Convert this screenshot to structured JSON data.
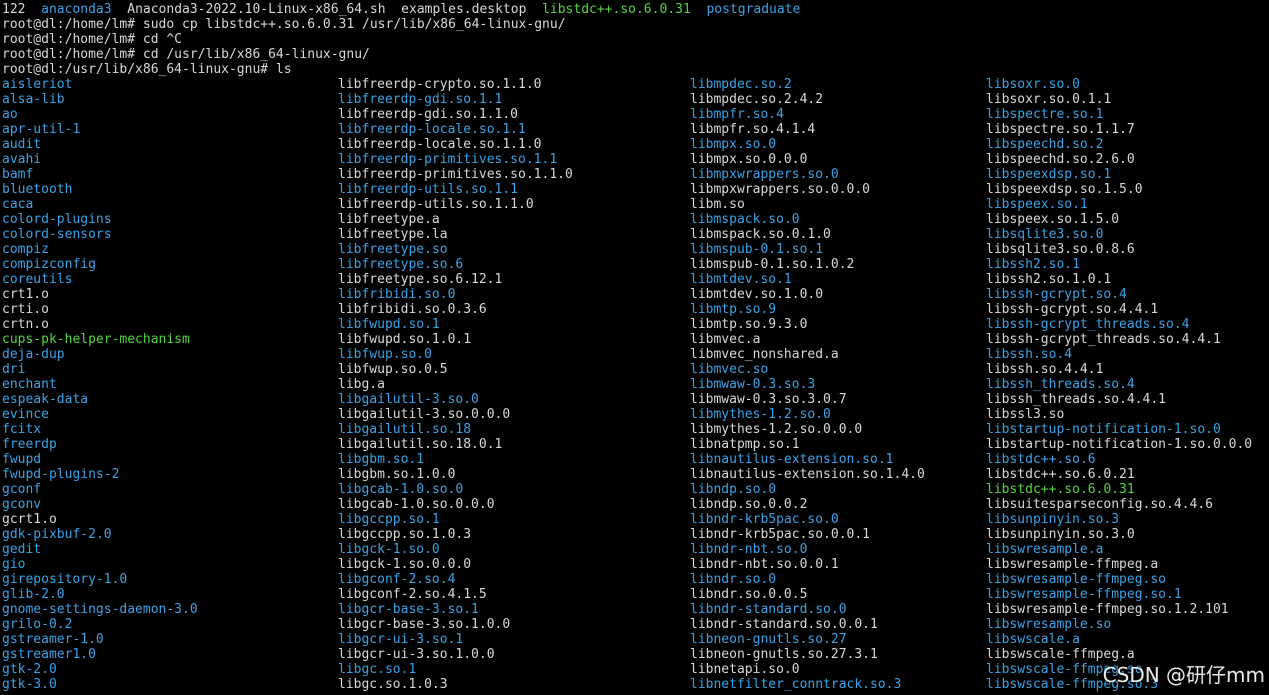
{
  "colors": {
    "background": "#000000",
    "default": "#d8d8d8",
    "blue": "#3ca2e6",
    "green": "#53d63e"
  },
  "top_lines": [
    [
      {
        "text": "122  ",
        "color": "default"
      },
      {
        "text": "anaconda3",
        "color": "blue"
      },
      {
        "text": "  Anaconda3-2022.10-Linux-x86_64.sh  examples.desktop  ",
        "color": "default"
      },
      {
        "text": "libstdc++.so.6.0.31",
        "color": "green"
      },
      {
        "text": "  ",
        "color": "default"
      },
      {
        "text": "postgraduate",
        "color": "blue"
      }
    ],
    [
      {
        "text": "root@dl:/home/lm# sudo cp libstdc++.so.6.0.31 /usr/lib/x86_64-linux-gnu/",
        "color": "default"
      }
    ],
    [
      {
        "text": "root@dl:/home/lm# cd ^C",
        "color": "default"
      }
    ],
    [
      {
        "text": "root@dl:/home/lm# cd /usr/lib/x86_64-linux-gnu/",
        "color": "default"
      }
    ],
    [
      {
        "text": "root@dl:/usr/lib/x86_64-linux-gnu# ls",
        "color": "default"
      }
    ]
  ],
  "ls_columns": [
    [
      {
        "text": "aisleriot",
        "color": "blue"
      },
      {
        "text": "alsa-lib",
        "color": "blue"
      },
      {
        "text": "ao",
        "color": "blue"
      },
      {
        "text": "apr-util-1",
        "color": "blue"
      },
      {
        "text": "audit",
        "color": "blue"
      },
      {
        "text": "avahi",
        "color": "blue"
      },
      {
        "text": "bamf",
        "color": "blue"
      },
      {
        "text": "bluetooth",
        "color": "blue"
      },
      {
        "text": "caca",
        "color": "blue"
      },
      {
        "text": "colord-plugins",
        "color": "blue"
      },
      {
        "text": "colord-sensors",
        "color": "blue"
      },
      {
        "text": "compiz",
        "color": "blue"
      },
      {
        "text": "compizconfig",
        "color": "blue"
      },
      {
        "text": "coreutils",
        "color": "blue"
      },
      {
        "text": "crt1.o",
        "color": "default"
      },
      {
        "text": "crti.o",
        "color": "default"
      },
      {
        "text": "crtn.o",
        "color": "default"
      },
      {
        "text": "cups-pk-helper-mechanism",
        "color": "green"
      },
      {
        "text": "deja-dup",
        "color": "blue"
      },
      {
        "text": "dri",
        "color": "blue"
      },
      {
        "text": "enchant",
        "color": "blue"
      },
      {
        "text": "espeak-data",
        "color": "blue"
      },
      {
        "text": "evince",
        "color": "blue"
      },
      {
        "text": "fcitx",
        "color": "blue"
      },
      {
        "text": "freerdp",
        "color": "blue"
      },
      {
        "text": "fwupd",
        "color": "blue"
      },
      {
        "text": "fwupd-plugins-2",
        "color": "blue"
      },
      {
        "text": "gconf",
        "color": "blue"
      },
      {
        "text": "gconv",
        "color": "blue"
      },
      {
        "text": "gcrt1.o",
        "color": "default"
      },
      {
        "text": "gdk-pixbuf-2.0",
        "color": "blue"
      },
      {
        "text": "gedit",
        "color": "blue"
      },
      {
        "text": "gio",
        "color": "blue"
      },
      {
        "text": "girepository-1.0",
        "color": "blue"
      },
      {
        "text": "glib-2.0",
        "color": "blue"
      },
      {
        "text": "gnome-settings-daemon-3.0",
        "color": "blue"
      },
      {
        "text": "grilo-0.2",
        "color": "blue"
      },
      {
        "text": "gstreamer-1.0",
        "color": "blue"
      },
      {
        "text": "gstreamer1.0",
        "color": "blue"
      },
      {
        "text": "gtk-2.0",
        "color": "blue"
      },
      {
        "text": "gtk-3.0",
        "color": "blue"
      }
    ],
    [
      {
        "text": "libfreerdp-crypto.so.1.1.0",
        "color": "default"
      },
      {
        "text": "libfreerdp-gdi.so.1.1",
        "color": "blue"
      },
      {
        "text": "libfreerdp-gdi.so.1.1.0",
        "color": "default"
      },
      {
        "text": "libfreerdp-locale.so.1.1",
        "color": "blue"
      },
      {
        "text": "libfreerdp-locale.so.1.1.0",
        "color": "default"
      },
      {
        "text": "libfreerdp-primitives.so.1.1",
        "color": "blue"
      },
      {
        "text": "libfreerdp-primitives.so.1.1.0",
        "color": "default"
      },
      {
        "text": "libfreerdp-utils.so.1.1",
        "color": "blue"
      },
      {
        "text": "libfreerdp-utils.so.1.1.0",
        "color": "default"
      },
      {
        "text": "libfreetype.a",
        "color": "default"
      },
      {
        "text": "libfreetype.la",
        "color": "default"
      },
      {
        "text": "libfreetype.so",
        "color": "blue"
      },
      {
        "text": "libfreetype.so.6",
        "color": "blue"
      },
      {
        "text": "libfreetype.so.6.12.1",
        "color": "default"
      },
      {
        "text": "libfribidi.so.0",
        "color": "blue"
      },
      {
        "text": "libfribidi.so.0.3.6",
        "color": "default"
      },
      {
        "text": "libfwupd.so.1",
        "color": "blue"
      },
      {
        "text": "libfwupd.so.1.0.1",
        "color": "default"
      },
      {
        "text": "libfwup.so.0",
        "color": "blue"
      },
      {
        "text": "libfwup.so.0.5",
        "color": "default"
      },
      {
        "text": "libg.a",
        "color": "default"
      },
      {
        "text": "libgailutil-3.so.0",
        "color": "blue"
      },
      {
        "text": "libgailutil-3.so.0.0.0",
        "color": "default"
      },
      {
        "text": "libgailutil.so.18",
        "color": "blue"
      },
      {
        "text": "libgailutil.so.18.0.1",
        "color": "default"
      },
      {
        "text": "libgbm.so.1",
        "color": "blue"
      },
      {
        "text": "libgbm.so.1.0.0",
        "color": "default"
      },
      {
        "text": "libgcab-1.0.so.0",
        "color": "blue"
      },
      {
        "text": "libgcab-1.0.so.0.0.0",
        "color": "default"
      },
      {
        "text": "libgccpp.so.1",
        "color": "blue"
      },
      {
        "text": "libgccpp.so.1.0.3",
        "color": "default"
      },
      {
        "text": "libgck-1.so.0",
        "color": "blue"
      },
      {
        "text": "libgck-1.so.0.0.0",
        "color": "default"
      },
      {
        "text": "libgconf-2.so.4",
        "color": "blue"
      },
      {
        "text": "libgconf-2.so.4.1.5",
        "color": "default"
      },
      {
        "text": "libgcr-base-3.so.1",
        "color": "blue"
      },
      {
        "text": "libgcr-base-3.so.1.0.0",
        "color": "default"
      },
      {
        "text": "libgcr-ui-3.so.1",
        "color": "blue"
      },
      {
        "text": "libgcr-ui-3.so.1.0.0",
        "color": "default"
      },
      {
        "text": "libgc.so.1",
        "color": "blue"
      },
      {
        "text": "libgc.so.1.0.3",
        "color": "default"
      }
    ],
    [
      {
        "text": "libmpdec.so.2",
        "color": "blue"
      },
      {
        "text": "libmpdec.so.2.4.2",
        "color": "default"
      },
      {
        "text": "libmpfr.so.4",
        "color": "blue"
      },
      {
        "text": "libmpfr.so.4.1.4",
        "color": "default"
      },
      {
        "text": "libmpx.so.0",
        "color": "blue"
      },
      {
        "text": "libmpx.so.0.0.0",
        "color": "default"
      },
      {
        "text": "libmpxwrappers.so.0",
        "color": "blue"
      },
      {
        "text": "libmpxwrappers.so.0.0.0",
        "color": "default"
      },
      {
        "text": "libm.so",
        "color": "default"
      },
      {
        "text": "libmspack.so.0",
        "color": "blue"
      },
      {
        "text": "libmspack.so.0.1.0",
        "color": "default"
      },
      {
        "text": "libmspub-0.1.so.1",
        "color": "blue"
      },
      {
        "text": "libmspub-0.1.so.1.0.2",
        "color": "default"
      },
      {
        "text": "libmtdev.so.1",
        "color": "blue"
      },
      {
        "text": "libmtdev.so.1.0.0",
        "color": "default"
      },
      {
        "text": "libmtp.so.9",
        "color": "blue"
      },
      {
        "text": "libmtp.so.9.3.0",
        "color": "default"
      },
      {
        "text": "libmvec.a",
        "color": "default"
      },
      {
        "text": "libmvec_nonshared.a",
        "color": "default"
      },
      {
        "text": "libmvec.so",
        "color": "blue"
      },
      {
        "text": "libmwaw-0.3.so.3",
        "color": "blue"
      },
      {
        "text": "libmwaw-0.3.so.3.0.7",
        "color": "default"
      },
      {
        "text": "libmythes-1.2.so.0",
        "color": "blue"
      },
      {
        "text": "libmythes-1.2.so.0.0.0",
        "color": "default"
      },
      {
        "text": "libnatpmp.so.1",
        "color": "default"
      },
      {
        "text": "libnautilus-extension.so.1",
        "color": "blue"
      },
      {
        "text": "libnautilus-extension.so.1.4.0",
        "color": "default"
      },
      {
        "text": "libndp.so.0",
        "color": "blue"
      },
      {
        "text": "libndp.so.0.0.2",
        "color": "default"
      },
      {
        "text": "libndr-krb5pac.so.0",
        "color": "blue"
      },
      {
        "text": "libndr-krb5pac.so.0.0.1",
        "color": "default"
      },
      {
        "text": "libndr-nbt.so.0",
        "color": "blue"
      },
      {
        "text": "libndr-nbt.so.0.0.1",
        "color": "default"
      },
      {
        "text": "libndr.so.0",
        "color": "blue"
      },
      {
        "text": "libndr.so.0.0.5",
        "color": "default"
      },
      {
        "text": "libndr-standard.so.0",
        "color": "blue"
      },
      {
        "text": "libndr-standard.so.0.0.1",
        "color": "default"
      },
      {
        "text": "libneon-gnutls.so.27",
        "color": "blue"
      },
      {
        "text": "libneon-gnutls.so.27.3.1",
        "color": "default"
      },
      {
        "text": "libnetapi.so.0",
        "color": "default"
      },
      {
        "text": "libnetfilter_conntrack.so.3",
        "color": "blue"
      }
    ],
    [
      {
        "text": "libsoxr.so.0",
        "color": "blue"
      },
      {
        "text": "libsoxr.so.0.1.1",
        "color": "default"
      },
      {
        "text": "libspectre.so.1",
        "color": "blue"
      },
      {
        "text": "libspectre.so.1.1.7",
        "color": "default"
      },
      {
        "text": "libspeechd.so.2",
        "color": "blue"
      },
      {
        "text": "libspeechd.so.2.6.0",
        "color": "default"
      },
      {
        "text": "libspeexdsp.so.1",
        "color": "blue"
      },
      {
        "text": "libspeexdsp.so.1.5.0",
        "color": "default"
      },
      {
        "text": "libspeex.so.1",
        "color": "blue"
      },
      {
        "text": "libspeex.so.1.5.0",
        "color": "default"
      },
      {
        "text": "libsqlite3.so.0",
        "color": "blue"
      },
      {
        "text": "libsqlite3.so.0.8.6",
        "color": "default"
      },
      {
        "text": "libssh2.so.1",
        "color": "blue"
      },
      {
        "text": "libssh2.so.1.0.1",
        "color": "default"
      },
      {
        "text": "libssh-gcrypt.so.4",
        "color": "blue"
      },
      {
        "text": "libssh-gcrypt.so.4.4.1",
        "color": "default"
      },
      {
        "text": "libssh-gcrypt_threads.so.4",
        "color": "blue"
      },
      {
        "text": "libssh-gcrypt_threads.so.4.4.1",
        "color": "default"
      },
      {
        "text": "libssh.so.4",
        "color": "blue"
      },
      {
        "text": "libssh.so.4.4.1",
        "color": "default"
      },
      {
        "text": "libssh_threads.so.4",
        "color": "blue"
      },
      {
        "text": "libssh_threads.so.4.4.1",
        "color": "default"
      },
      {
        "text": "libssl3.so",
        "color": "default"
      },
      {
        "text": "libstartup-notification-1.so.0",
        "color": "blue"
      },
      {
        "text": "libstartup-notification-1.so.0.0.0",
        "color": "default"
      },
      {
        "text": "libstdc++.so.6",
        "color": "blue"
      },
      {
        "text": "libstdc++.so.6.0.21",
        "color": "default"
      },
      {
        "text": "libstdc++.so.6.0.31",
        "color": "green"
      },
      {
        "text": "libsuitesparseconfig.so.4.4.6",
        "color": "default"
      },
      {
        "text": "libsunpinyin.so.3",
        "color": "blue"
      },
      {
        "text": "libsunpinyin.so.3.0",
        "color": "default"
      },
      {
        "text": "libswresample.a",
        "color": "blue"
      },
      {
        "text": "libswresample-ffmpeg.a",
        "color": "default"
      },
      {
        "text": "libswresample-ffmpeg.so",
        "color": "blue"
      },
      {
        "text": "libswresample-ffmpeg.so.1",
        "color": "blue"
      },
      {
        "text": "libswresample-ffmpeg.so.1.2.101",
        "color": "default"
      },
      {
        "text": "libswresample.so",
        "color": "blue"
      },
      {
        "text": "libswscale.a",
        "color": "blue"
      },
      {
        "text": "libswscale-ffmpeg.a",
        "color": "default"
      },
      {
        "text": "libswscale-ffmpeg.so",
        "color": "blue"
      },
      {
        "text": "libswscale-ffmpeg.so.3",
        "color": "blue"
      }
    ]
  ],
  "watermark": "CSDN @研仔mm"
}
